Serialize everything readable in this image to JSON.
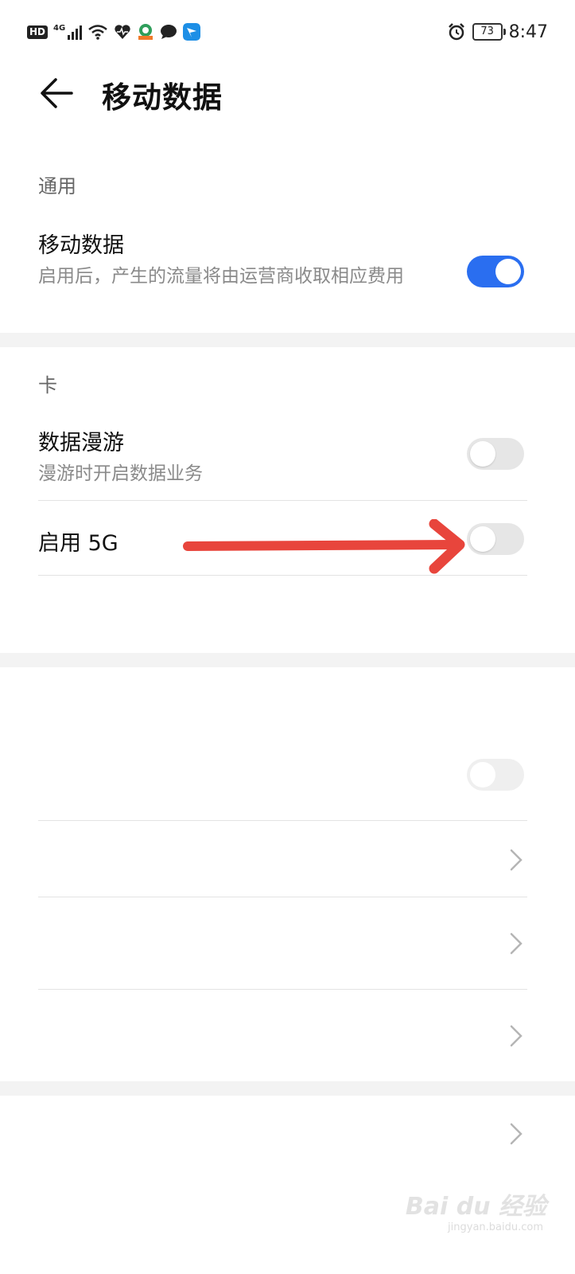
{
  "status_bar": {
    "hd": "HD",
    "network": "4G",
    "battery": "73",
    "time": "8:47",
    "icons": [
      "signal-icon",
      "wifi-icon",
      "health-icon",
      "app-icon",
      "message-icon",
      "app-icon-blue",
      "alarm-icon"
    ]
  },
  "header": {
    "title": "移动数据",
    "back_icon": "arrow-left-icon"
  },
  "general": {
    "section_title": "通用",
    "mobile_data": {
      "title": "移动数据",
      "subtitle": "启用后，产生的流量将由运营商收取相应费用",
      "enabled": true
    }
  },
  "card": {
    "section_title": "卡",
    "roaming": {
      "title": "数据漫游",
      "subtitle": "漫游时开启数据业务",
      "enabled": false
    },
    "enable_5g": {
      "title": "启用 5G",
      "enabled": false
    }
  },
  "colors": {
    "accent": "#2a6ef0",
    "arrow": "#e8453c"
  },
  "watermark": {
    "brand": "Bai du 经验",
    "url": "jingyan.baidu.com"
  }
}
